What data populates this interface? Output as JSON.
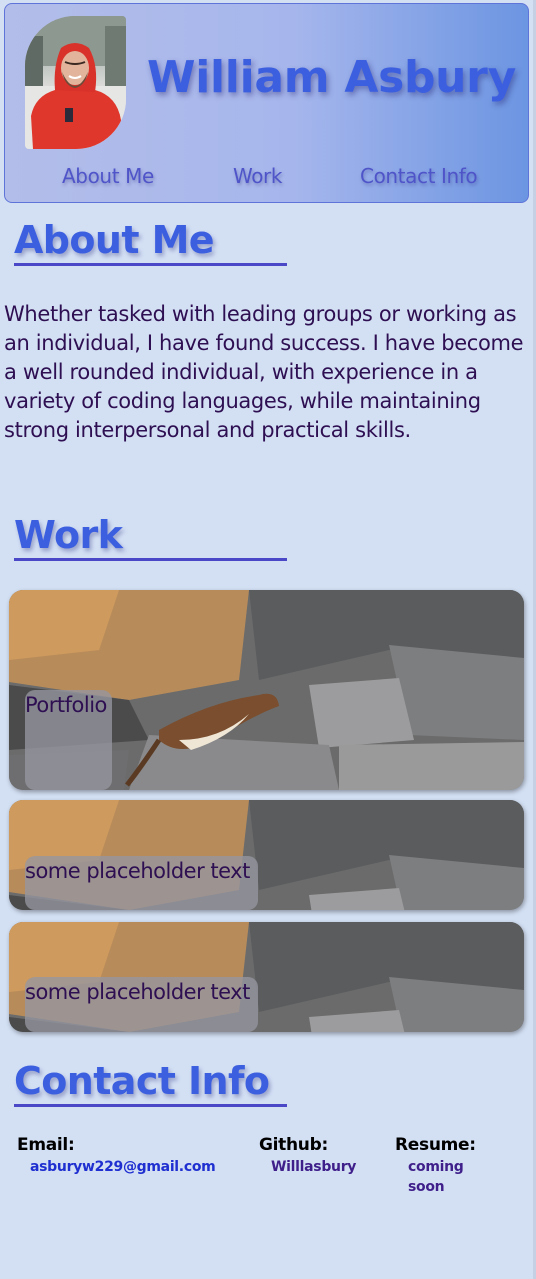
{
  "header": {
    "name": "William Asbury",
    "avatar_alt": "Portrait of William Asbury in a red hooded jacket"
  },
  "nav": {
    "items": [
      {
        "label": "About Me"
      },
      {
        "label": "Work"
      },
      {
        "label": "Contact Info"
      }
    ]
  },
  "about": {
    "heading": "About Me",
    "text": "Whether tasked with leading groups or working as an individual, I have found success. I have become a well rounded individual, with experience in a variety of coding languages, while maintaining strong interpersonal and practical skills."
  },
  "work": {
    "heading": "Work",
    "cards": [
      {
        "label": "Portfolio"
      },
      {
        "label": "some placeholder text"
      },
      {
        "label": "some placeholder text"
      }
    ]
  },
  "contact": {
    "heading": "Contact Info",
    "email": {
      "title": "Email:",
      "value": "asburyw229@gmail.com"
    },
    "github": {
      "title": "Github:",
      "value": "Willlasbury"
    },
    "resume": {
      "title": "Resume:",
      "value": "coming soon"
    }
  },
  "colors": {
    "background": "#d3e0f4",
    "heading": "#3c5fe0",
    "text": "#2e0f52",
    "email_link": "#1f2fd0",
    "github_link": "#3f1f8a"
  },
  "icons": {
    "avatar": "person-portrait",
    "card_background": "weasel-on-rocks-photo"
  }
}
